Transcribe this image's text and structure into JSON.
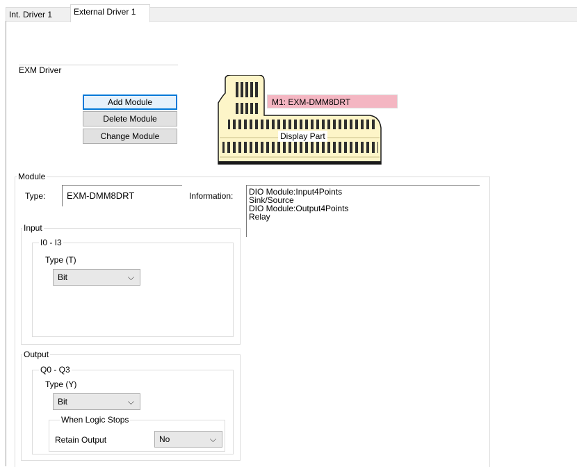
{
  "tabs": [
    {
      "label": "Int. Driver 1"
    },
    {
      "label": "External Driver 1"
    }
  ],
  "driver": {
    "title": "EXM Driver",
    "buttons": {
      "add": "Add Module",
      "delete": "Delete Module",
      "change": "Change Module"
    }
  },
  "display": {
    "module_label": "M1: EXM-DMM8DRT",
    "part_label": "Display Part",
    "highlight_color": "#f4b6c2"
  },
  "module": {
    "group_label": "Module",
    "type_label": "Type:",
    "type_value": "EXM-DMM8DRT",
    "info_label": "Information:",
    "info_lines": [
      "DIO Module:Input4Points",
      "Sink/Source",
      "DIO Module:Output4Points",
      "Relay"
    ]
  },
  "input": {
    "group_label": "Input",
    "sub_label": "I0 - I3",
    "type_label": "Type (T)",
    "type_value": "Bit"
  },
  "output": {
    "group_label": "Output",
    "sub_label": "Q0 - Q3",
    "type_label": "Type (Y)",
    "type_value": "Bit",
    "logic_label": "When Logic Stops",
    "retain_label": "Retain Output",
    "retain_value": "No"
  }
}
